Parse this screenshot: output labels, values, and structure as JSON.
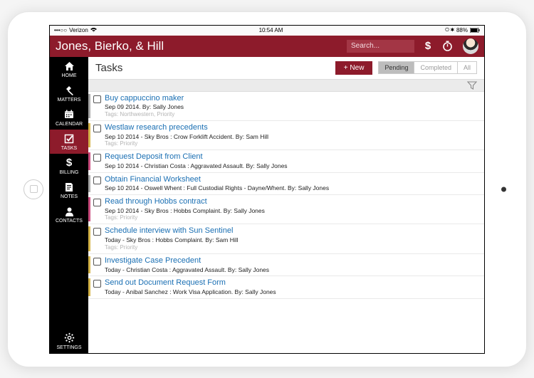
{
  "statusbar": {
    "carrier": "Verizon",
    "time": "10:54 AM",
    "battery": "88%"
  },
  "header": {
    "title": "Jones, Bierko, & Hill",
    "search_placeholder": "Search...",
    "dollar_icon": "$"
  },
  "sidebar": {
    "items": [
      {
        "key": "home",
        "label": "HOME"
      },
      {
        "key": "matters",
        "label": "MATTERS"
      },
      {
        "key": "calendar",
        "label": "CALENDAR"
      },
      {
        "key": "tasks",
        "label": "TASKS"
      },
      {
        "key": "billing",
        "label": "BILLING"
      },
      {
        "key": "notes",
        "label": "NOTES"
      },
      {
        "key": "contacts",
        "label": "CONTACTS"
      },
      {
        "key": "settings",
        "label": "SETTINGS"
      }
    ],
    "active": "tasks"
  },
  "main": {
    "title": "Tasks",
    "new_button": "+ New",
    "filters": {
      "pending": "Pending",
      "completed": "Completed",
      "all": "All",
      "active": "pending"
    }
  },
  "colors": {
    "brand": "#8d1b2b",
    "link": "#1a6fb3"
  },
  "tasks": [
    {
      "title": "Buy cappuccino maker",
      "meta": "Sep 09 2014. By: Sally Jones",
      "tags": "Tags: Northwestern, Priority",
      "stripe": "#a8a8a8"
    },
    {
      "title": "Westlaw research precedents",
      "meta": "Sep 10 2014 - Sky Bros : Crow Forklift Accident. By: Sam Hill",
      "tags": "Tags: Priority",
      "stripe": "#d4b349"
    },
    {
      "title": "Request Deposit from Client",
      "meta": "Sep 10 2014 - Christian Costa : Aggravated Assault. By: Sally Jones",
      "tags": "",
      "stripe": "#c94b7d"
    },
    {
      "title": "Obtain Financial Worksheet",
      "meta": "Sep 10 2014 - Oswell Whent : Full Custodial Rights - Dayne/Whent. By: Sally Jones",
      "tags": "",
      "stripe": "#a8a8a8"
    },
    {
      "title": "Read through Hobbs contract",
      "meta": "Sep 10 2014 - Sky Bros : Hobbs Complaint. By: Sally Jones",
      "tags": "Tags: Priority",
      "stripe": "#c94b7d"
    },
    {
      "title": "Schedule interview with Sun Sentinel",
      "meta": "Today - Sky Bros : Hobbs Complaint. By: Sam Hill",
      "tags": "Tags: Priority",
      "stripe": "#d4b349"
    },
    {
      "title": "Investigate Case Precedent",
      "meta": "Today - Christian Costa : Aggravated Assault. By: Sally Jones",
      "tags": "",
      "stripe": "#d4b349"
    },
    {
      "title": "Send out Document Request Form",
      "meta": "Today - Anibal Sanchez : Work Visa Application. By: Sally Jones",
      "tags": "",
      "stripe": "#d4b349"
    }
  ]
}
